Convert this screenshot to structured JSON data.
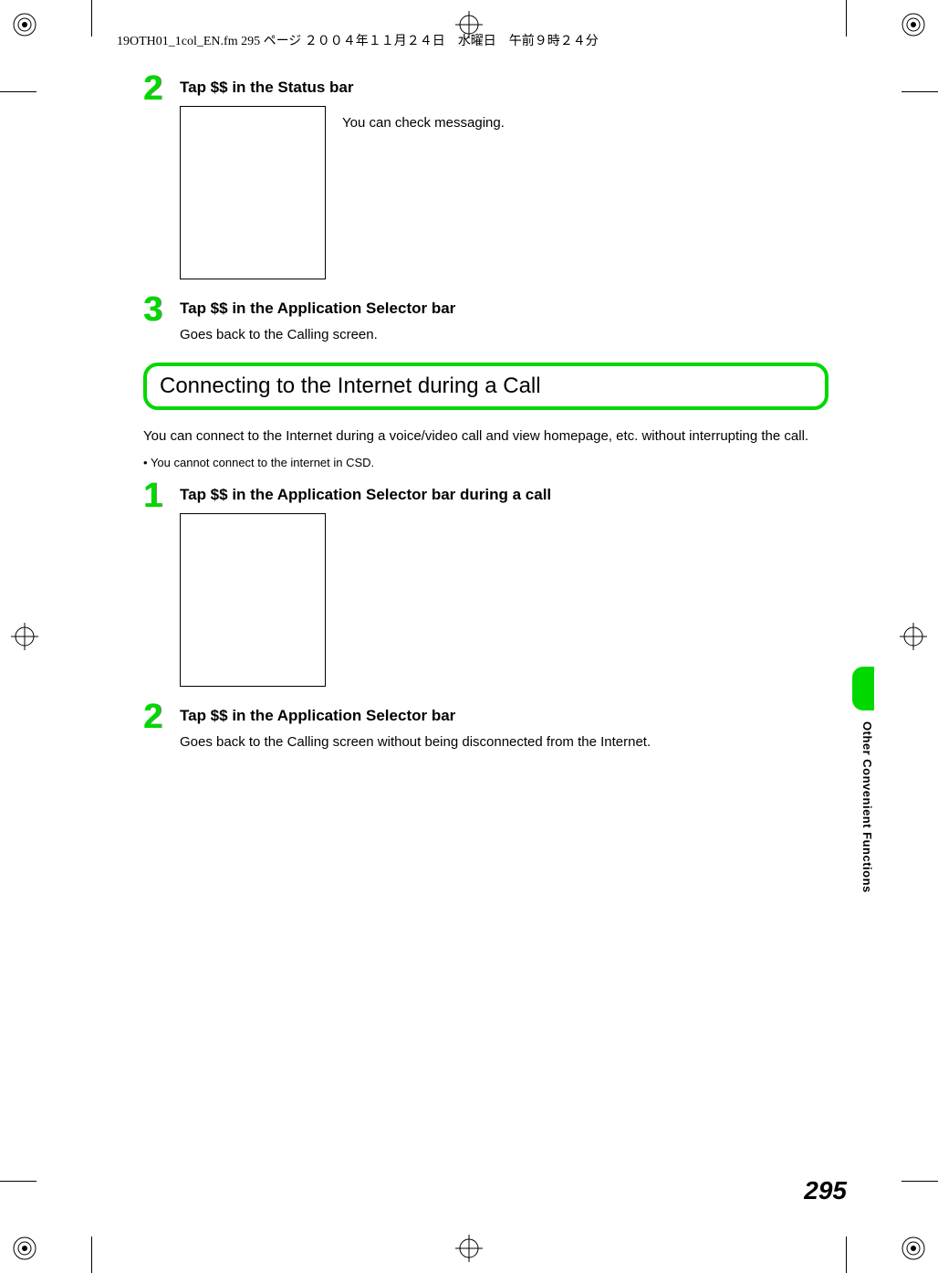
{
  "header": "19OTH01_1col_EN.fm  295 ページ  ２００４年１１月２４日　水曜日　午前９時２４分",
  "step2": {
    "number": "2",
    "title": "Tap $$ in the Status bar",
    "desc": "You can check messaging."
  },
  "step3": {
    "number": "3",
    "title": "Tap $$ in the Application Selector bar",
    "desc": "Goes back to the Calling screen."
  },
  "section": {
    "heading": "Connecting to the Internet during a Call",
    "intro": "You can connect to the Internet during a voice/video call and view homepage, etc. without interrupting the call.",
    "note": "You cannot connect to the internet in CSD."
  },
  "stepA1": {
    "number": "1",
    "title": "Tap $$ in the Application Selector bar during a call"
  },
  "stepA2": {
    "number": "2",
    "title": "Tap $$ in the Application Selector bar",
    "desc": "Goes back to the Calling screen without being disconnected from the Internet."
  },
  "sideLabel": "Other Convenient Functions",
  "pageNumber": "295"
}
